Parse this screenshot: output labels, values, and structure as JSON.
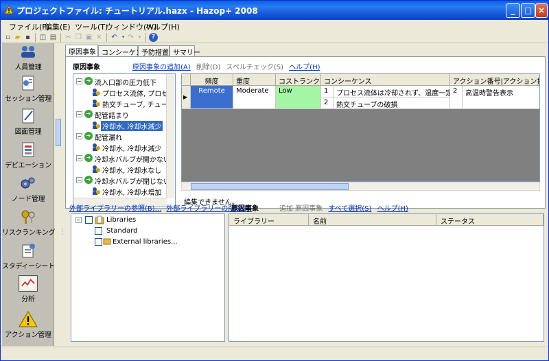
{
  "window": {
    "title": "プロジェクトファイル: チュートリアル.hazx - Hazop+ 2008"
  },
  "menu": [
    "ファイル(F)",
    "編集(E)",
    "ツール(T)",
    "ウィンドウ(W)",
    "ヘルプ(H)"
  ],
  "sidebar": {
    "items": [
      {
        "label": "人員管理",
        "icon": "people-icon"
      },
      {
        "label": "セッション管理",
        "icon": "session-icon"
      },
      {
        "label": "図面管理",
        "icon": "drawing-icon"
      },
      {
        "label": "デビエーション",
        "icon": "deviation-icon"
      },
      {
        "label": "ノード管理",
        "icon": "gears-icon"
      },
      {
        "label": "リスクランキング管理",
        "icon": "keys-icon"
      },
      {
        "label": "スタディーシート",
        "icon": "study-sheet-icon"
      },
      {
        "label": "分析",
        "icon": "analysis-chart-icon"
      },
      {
        "label": "アクション管理",
        "icon": "warning-icon"
      }
    ],
    "selected": "分析"
  },
  "tabs": [
    "原因事象",
    "コンシーケンス",
    "予防措置",
    "サマリー"
  ],
  "cause_panel": {
    "title": "原因事象",
    "links": [
      "原因事象の追加(A)",
      "削除(D)",
      "スペルチェック(S)",
      "ヘルプ(H)"
    ],
    "tree": [
      {
        "level": 0,
        "label": "流入口部の圧力低下",
        "type": "deviation"
      },
      {
        "level": 1,
        "label": "プロセス流体, プロセス流",
        "type": "cause"
      },
      {
        "level": 1,
        "label": "熱交チューブ, チューブ圧",
        "type": "cause"
      },
      {
        "level": 0,
        "label": "配管詰まり",
        "type": "deviation"
      },
      {
        "level": 1,
        "label": "冷却水, 冷却水減少",
        "type": "cause",
        "selected": true
      },
      {
        "level": 0,
        "label": "配管漏れ",
        "type": "deviation"
      },
      {
        "level": 1,
        "label": "冷却水, 冷却水減少",
        "type": "cause"
      },
      {
        "level": 0,
        "label": "冷却水バルブが開かない",
        "type": "deviation"
      },
      {
        "level": 1,
        "label": "冷却水, 冷却水なし",
        "type": "cause"
      },
      {
        "level": 0,
        "label": "冷却水バルブが閉じない",
        "type": "deviation"
      },
      {
        "level": 1,
        "label": "冷却水, 冷却水增加",
        "type": "cause"
      }
    ],
    "grid": {
      "columns": [
        "頻度",
        "重度",
        "コストランク",
        "コンシーケンス",
        "アクション番号|アクション提"
      ],
      "row": {
        "frequency": "Remote",
        "severity": "Moderate",
        "cost_rank": "Low",
        "consequences": [
          {
            "no": "1",
            "text": "プロセス流体は冷却されず、温度一定を保つ"
          },
          {
            "no": "2",
            "text": "熱交チューブの破損"
          }
        ],
        "action_no": "2",
        "action_text": "高温時警告表示"
      }
    },
    "status": "編集できません。"
  },
  "library": {
    "links": [
      "外部ライブラリーの参照(B)...",
      "外部ライブラリーの削除(R)"
    ],
    "tree": [
      "Libraries",
      "Standard",
      "External libraries..."
    ],
    "right_title": "原因事象",
    "right_links": [
      "追加 原因事象",
      "すべて選択(S)",
      "ヘルプ(H)"
    ],
    "columns": [
      "ライブラリー",
      "名前",
      "ステータス"
    ]
  },
  "colors": {
    "frequency": "#3b6fcf",
    "cost_rank": "#a4f5a4",
    "selection": "#316ac5"
  }
}
